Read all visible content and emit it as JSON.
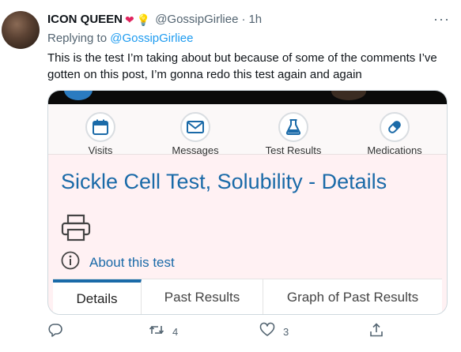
{
  "tweet": {
    "display_name": "ICON QUEEN",
    "emojis": [
      "❤",
      "💡"
    ],
    "handle": "@GossipGirliee",
    "separator": "·",
    "time": "1h",
    "more": "···",
    "replying_prefix": "Replying to ",
    "replying_to": "@GossipGirliee",
    "text": "This is the test I’m taking about but because of some of the comments I’ve gotten on this post, I’m gonna redo this test again and again"
  },
  "media": {
    "nav": [
      {
        "label": "Visits",
        "icon": "calendar-icon"
      },
      {
        "label": "Messages",
        "icon": "envelope-icon"
      },
      {
        "label": "Test Results",
        "icon": "flask-icon"
      },
      {
        "label": "Medications",
        "icon": "pill-icon"
      }
    ],
    "title": "Sickle Cell Test, Solubility - Details",
    "about_label": "About this test",
    "tabs": [
      "Details",
      "Past Results",
      "Graph of Past Results"
    ],
    "active_tab": "Details"
  },
  "actions": {
    "retweets": "4",
    "likes": "3"
  },
  "colors": {
    "link": "#1d9bf0",
    "mychart_blue": "#1a6aa8",
    "media_bg": "#fff1f3",
    "heart": "#e0245e"
  }
}
